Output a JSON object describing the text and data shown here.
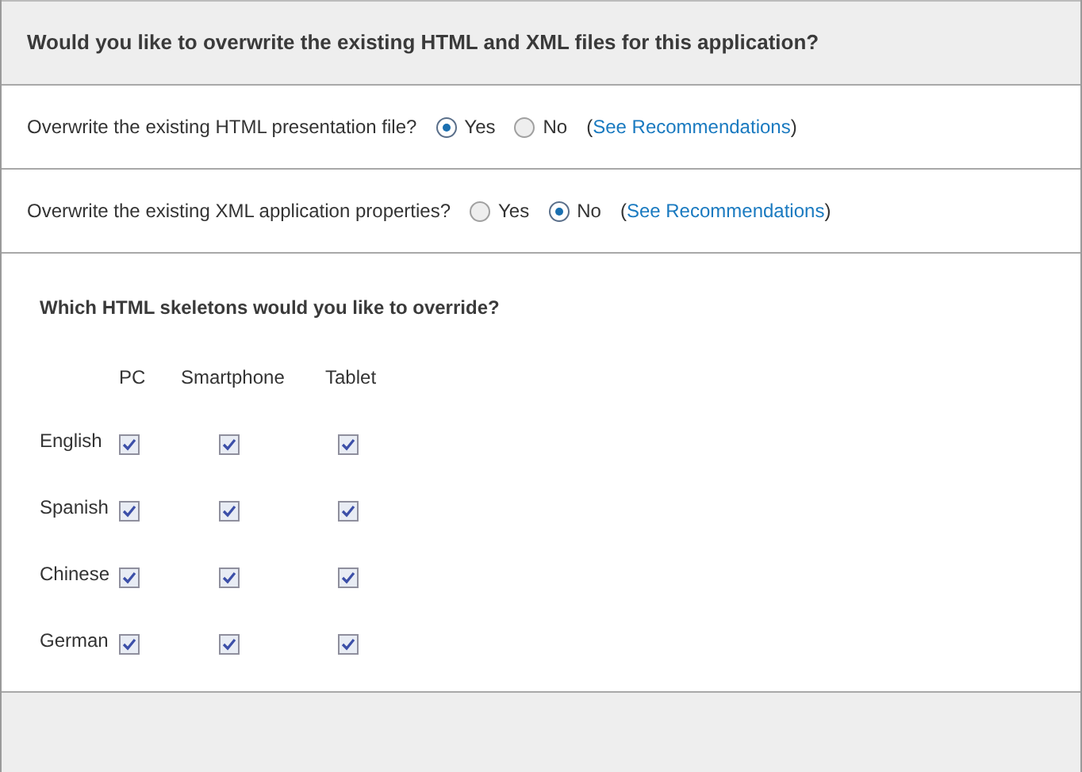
{
  "title": "Would you like to overwrite the existing HTML and XML files for this application?",
  "questions": [
    {
      "label": "Overwrite the existing HTML presentation file?",
      "options": [
        {
          "label": "Yes",
          "selected": true
        },
        {
          "label": "No",
          "selected": false
        }
      ],
      "open": "(",
      "link": "See Recommendations",
      "close": ")"
    },
    {
      "label": "Overwrite the existing XML application properties?",
      "options": [
        {
          "label": "Yes",
          "selected": false
        },
        {
          "label": "No",
          "selected": true
        }
      ],
      "open": "(",
      "link": "See Recommendations",
      "close": ")"
    }
  ],
  "skeletons": {
    "heading": "Which HTML skeletons would you like to override?",
    "columns": [
      "PC",
      "Smartphone",
      "Tablet"
    ],
    "rows": [
      {
        "language": "English",
        "checks": [
          {
            "checked": true
          },
          {
            "checked": true
          },
          {
            "checked": true
          }
        ]
      },
      {
        "language": "Spanish",
        "checks": [
          {
            "checked": true
          },
          {
            "checked": true
          },
          {
            "checked": true
          }
        ]
      },
      {
        "language": "Chinese",
        "checks": [
          {
            "checked": true
          },
          {
            "checked": true
          },
          {
            "checked": true
          }
        ]
      },
      {
        "language": "German",
        "checks": [
          {
            "checked": true
          },
          {
            "checked": true
          },
          {
            "checked": true
          }
        ]
      }
    ]
  }
}
